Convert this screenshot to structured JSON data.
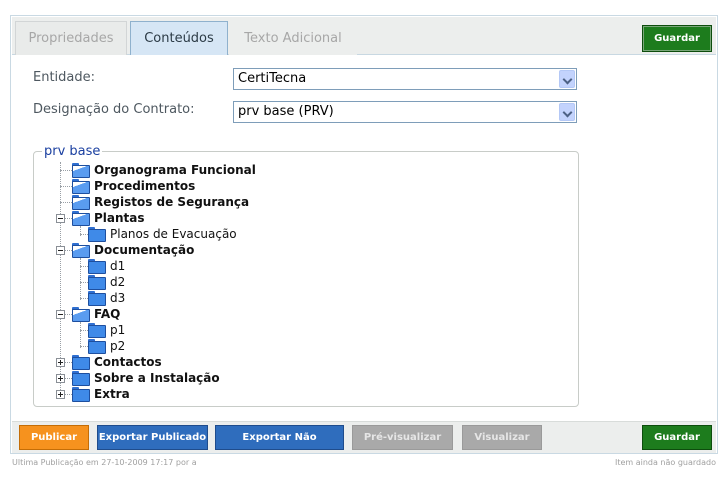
{
  "tabs": [
    {
      "label": "Propriedades"
    },
    {
      "label": "Conteúdos"
    },
    {
      "label": "Texto Adicional"
    }
  ],
  "header": {
    "save_label": "Guardar"
  },
  "form": {
    "entity_label": "Entidade:",
    "entity_value": "CertiTecna",
    "contract_label": "Designação do Contrato:",
    "contract_value": "prv base (PRV)"
  },
  "tree": {
    "root": "prv base",
    "items": [
      {
        "label": "Organograma Funcional"
      },
      {
        "label": "Procedimentos"
      },
      {
        "label": "Registos de Segurança"
      },
      {
        "label": "Plantas",
        "children": [
          "Planos de Evacuação"
        ]
      },
      {
        "label": "Documentação",
        "children": [
          "d1",
          "d2",
          "d3"
        ]
      },
      {
        "label": "FAQ",
        "children": [
          "p1",
          "p2"
        ]
      },
      {
        "label": "Contactos"
      },
      {
        "label": "Sobre a Instalação"
      },
      {
        "label": "Extra"
      }
    ]
  },
  "actions": {
    "publish": "Publicar",
    "export_published": "Exportar Publicado",
    "export_unpublished": "Exportar Não Publicado",
    "preview": "Pré-visualizar",
    "view": "Visualizar",
    "save": "Guardar"
  },
  "footer": {
    "last_publication": "Ultima Publicação em 27-10-2009 17:17 por a",
    "status": "Item ainda não guardado"
  },
  "colors": {
    "accent_green": "#1d7c1d",
    "publish_orange": "#f6921e",
    "action_blue": "#2f6dbd",
    "disabled_gray": "#a9a9a9"
  }
}
